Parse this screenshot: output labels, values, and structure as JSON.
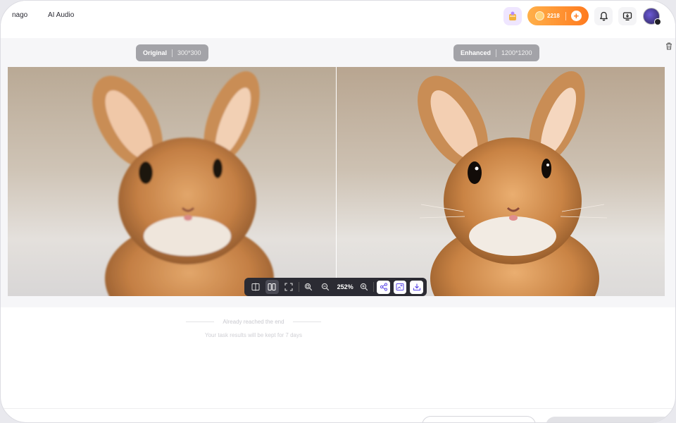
{
  "header": {
    "nav": [
      "nago",
      "AI Audio"
    ],
    "credits": "2218",
    "credits_add": "+"
  },
  "compare": {
    "original": {
      "name": "Original",
      "resolution": "300*300"
    },
    "enhanced": {
      "name": "Enhanced",
      "resolution": "1200*1200"
    }
  },
  "toolbar": {
    "zoom": "252%"
  },
  "footer": {
    "end_text": "Already reached the end",
    "keep_text": "Your task results will be kept for 7 days"
  },
  "colors": {
    "accent": "#ff7a1e",
    "toolbar_bg": "#2b2b33",
    "action_icon": "#5b48e6"
  }
}
